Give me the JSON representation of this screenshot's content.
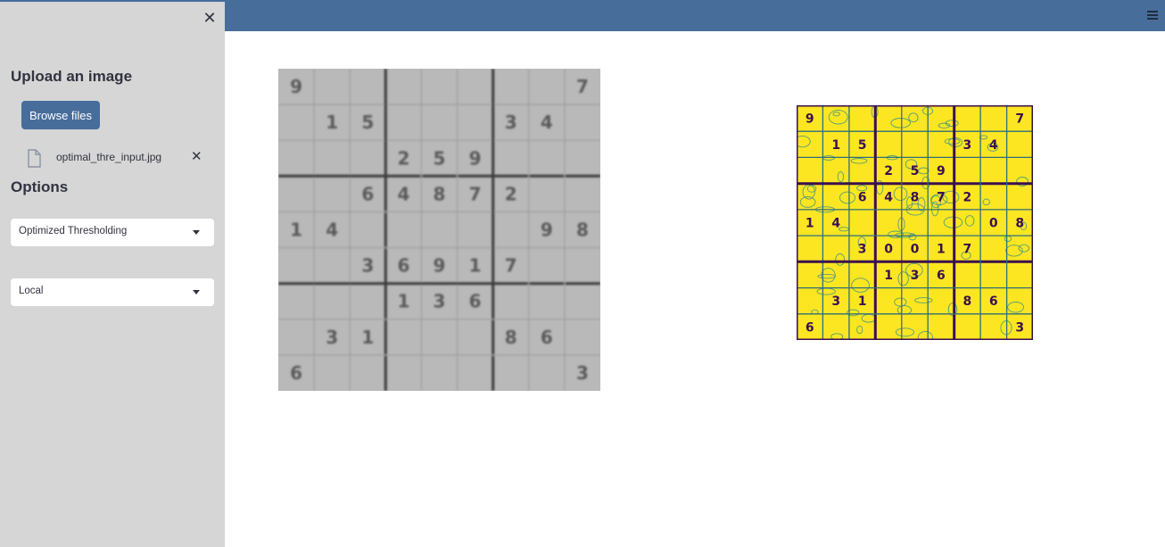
{
  "sidebar": {
    "upload_heading": "Upload an image",
    "browse_label": "Browse files",
    "file_name": "optimal_thre_input.jpg",
    "options_heading": "Options",
    "method_select": {
      "selected": "Optimized Thresholding"
    },
    "scope_select": {
      "selected": "Local"
    }
  },
  "colors": {
    "header": "#476d9b",
    "sidebar_bg": "#d6d6d6",
    "button": "#476d9b",
    "output_fill": "#fbe621",
    "output_ink": "#3b0f4f"
  },
  "icons": [
    "close-icon",
    "file-icon",
    "remove-file-icon",
    "chevron-down-icon",
    "menu-icon"
  ],
  "input_grid": [
    [
      "9",
      "",
      "",
      "",
      "",
      "",
      "",
      "",
      "7"
    ],
    [
      "",
      "1",
      "5",
      "",
      "",
      "",
      "3",
      "4",
      ""
    ],
    [
      "",
      "",
      "",
      "2",
      "5",
      "9",
      "",
      "",
      ""
    ],
    [
      "",
      "",
      "6",
      "4",
      "8",
      "7",
      "2",
      "",
      ""
    ],
    [
      "1",
      "4",
      "",
      "",
      "",
      "",
      "",
      "9",
      "8"
    ],
    [
      "",
      "",
      "3",
      "6",
      "9",
      "1",
      "7",
      "",
      ""
    ],
    [
      "",
      "",
      "",
      "1",
      "3",
      "6",
      "",
      "",
      ""
    ],
    [
      "",
      "3",
      "1",
      "",
      "",
      "",
      "8",
      "6",
      ""
    ],
    [
      "6",
      "",
      "",
      "",
      "",
      "",
      "",
      "",
      "3"
    ]
  ],
  "output_grid": [
    [
      "9",
      "",
      "",
      "",
      "",
      "",
      "",
      "",
      "7"
    ],
    [
      "",
      "1",
      "5",
      "",
      "",
      "",
      "3",
      "4",
      ""
    ],
    [
      "",
      "",
      "",
      "2",
      "5",
      "9",
      "",
      "",
      ""
    ],
    [
      "",
      "",
      "6",
      "4",
      "8",
      "7",
      "2",
      "",
      ""
    ],
    [
      "1",
      "4",
      "",
      "",
      "",
      "",
      "",
      "0",
      "8"
    ],
    [
      "",
      "",
      "3",
      "0",
      "0",
      "1",
      "7",
      "",
      ""
    ],
    [
      "",
      "",
      "",
      "1",
      "3",
      "6",
      "",
      "",
      ""
    ],
    [
      "",
      "3",
      "1",
      "",
      "",
      "",
      "8",
      "6",
      ""
    ],
    [
      "6",
      "",
      "",
      "",
      "",
      "",
      "",
      "",
      "3"
    ]
  ]
}
